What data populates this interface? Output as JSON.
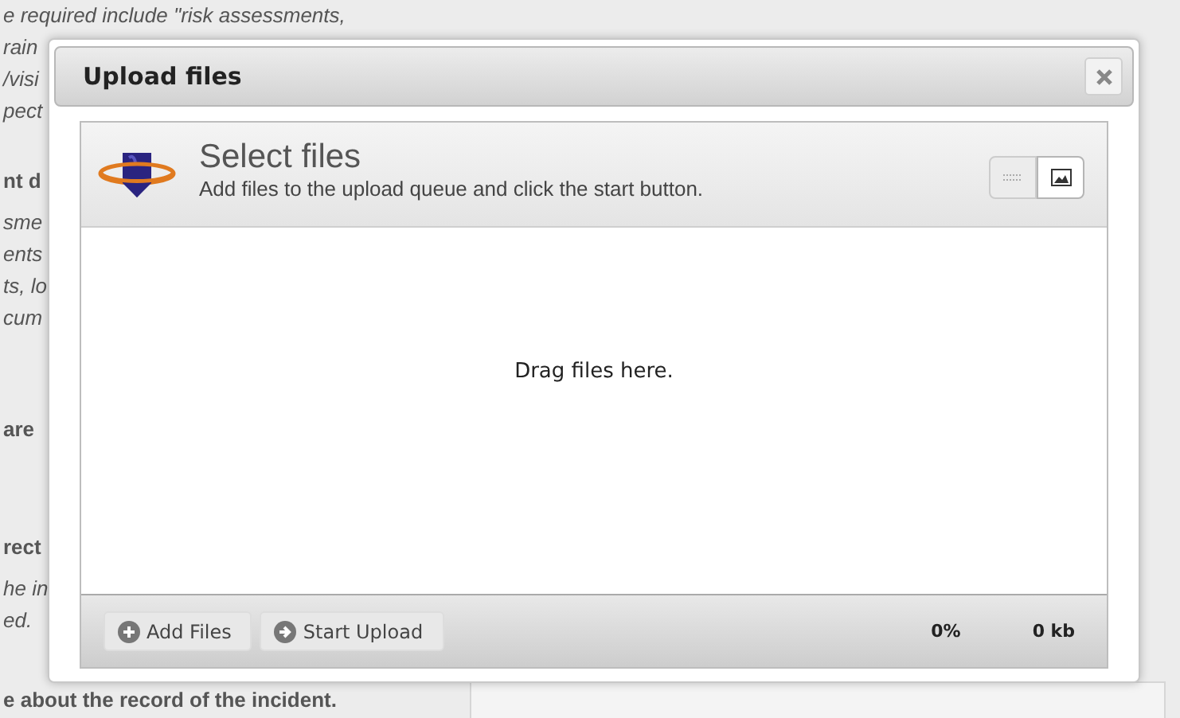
{
  "background_text": [
    {
      "kind": "italic",
      "lines": [
        "e required include \"risk assessments,",
        "rain",
        "/visi",
        "pect"
      ]
    },
    {
      "kind": "bold",
      "lines": [
        "nt d"
      ]
    },
    {
      "kind": "italic",
      "lines": [
        "sme",
        "ents",
        "ts, lo",
        "cum"
      ]
    },
    {
      "kind": "bold",
      "lines": [
        "are"
      ]
    },
    {
      "kind": "bold",
      "lines": [
        "rect"
      ]
    },
    {
      "kind": "italic",
      "lines": [
        "he in",
        "ed."
      ]
    },
    {
      "kind": "bold",
      "lines": [
        "e about the record of the incident."
      ]
    }
  ],
  "dialog": {
    "title": "Upload files",
    "header": {
      "title": "Select files",
      "subtitle": "Add files to the upload queue and click the start button.",
      "views": [
        {
          "kind": "list",
          "selected": false
        },
        {
          "kind": "thumbs",
          "selected": true
        }
      ]
    },
    "drop_text": "Drag files here.",
    "buttons": [
      {
        "kind": "add",
        "label": "Add Files"
      },
      {
        "kind": "start",
        "label": "Start Upload"
      }
    ],
    "percent": "0%",
    "size": "0 kb"
  }
}
